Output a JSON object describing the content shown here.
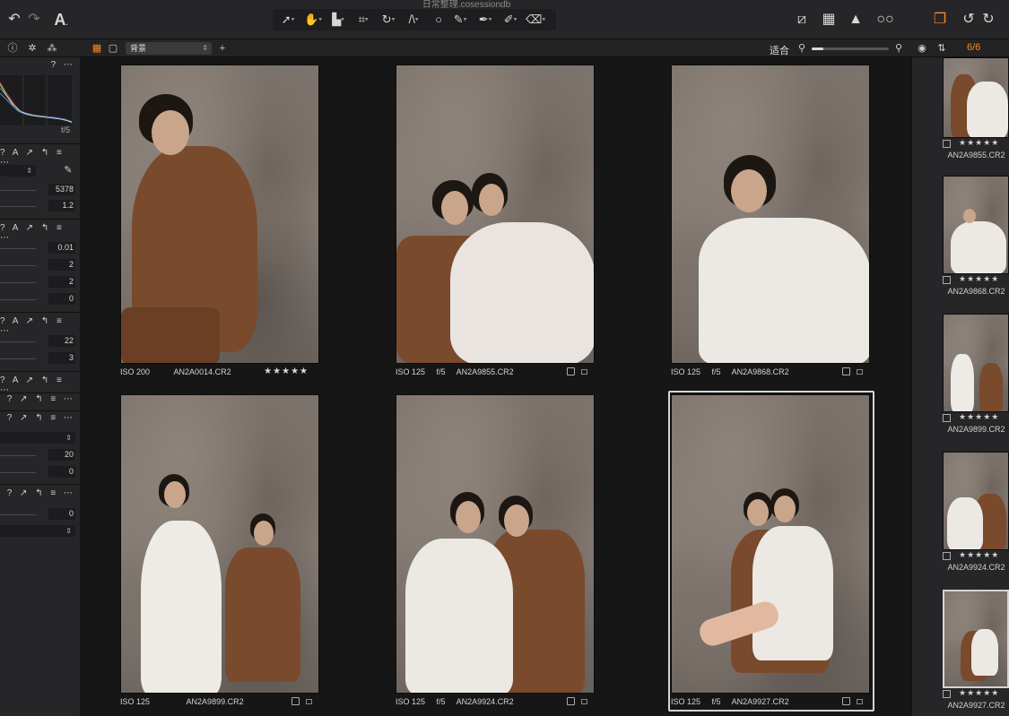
{
  "window": {
    "title": "日常整理.cosessiondb"
  },
  "toolbar": {
    "left_icons": [
      "undo-icon",
      "redo-icon",
      "text-tool-icon"
    ],
    "tools": [
      "select-cursor-icon",
      "pan-hand-icon",
      "stack-icon",
      "crop-icon",
      "rotate-icon",
      "keystone-icon",
      "spot-circle-icon",
      "brush-icon",
      "pen-icon",
      "eraser-icon",
      "gradient-icon"
    ],
    "right_icons": [
      "overlay-icon",
      "grid-icon",
      "warning-icon",
      "glasses-icon",
      "layers-icon",
      "rotate-left-icon",
      "rotate-right-icon"
    ]
  },
  "subbar": {
    "layer_select": "背景",
    "fit_label": "适合",
    "zoom_fraction": 0.15,
    "image_count": "6/6"
  },
  "left_panel": {
    "histogram_label": "f/5",
    "rows_a": [
      "5378",
      "1.2"
    ],
    "rows_b": [
      "0.01",
      "2",
      "2",
      "0"
    ],
    "rows_c": [
      "22",
      "3"
    ],
    "rows_d": [
      "20",
      "0"
    ],
    "rows_e": [
      "0"
    ],
    "header_icons": "? A ↗ ↰ ≡ ⋯"
  },
  "thumbnails": [
    {
      "iso": "ISO 200",
      "aperture": "",
      "name": "AN2A0014.CR2",
      "stars": "★★★★★",
      "selected": false
    },
    {
      "iso": "ISO 125",
      "aperture": "f/5",
      "name": "AN2A9855.CR2",
      "stars": "",
      "selected": false
    },
    {
      "iso": "ISO 125",
      "aperture": "f/5",
      "name": "AN2A9868.CR2",
      "stars": "",
      "selected": false
    },
    {
      "iso": "ISO 125",
      "aperture": "",
      "name": "AN2A9899.CR2",
      "stars": "",
      "selected": false
    },
    {
      "iso": "ISO 125",
      "aperture": "f/5",
      "name": "AN2A9924.CR2",
      "stars": "",
      "selected": false
    },
    {
      "iso": "ISO 125",
      "aperture": "f/5",
      "name": "AN2A9927.CR2",
      "stars": "",
      "selected": true
    }
  ],
  "filmstrip": [
    {
      "name": "AN2A9855.CR2",
      "stars": "★★★★★"
    },
    {
      "name": "AN2A9868.CR2",
      "stars": "★★★★★"
    },
    {
      "name": "AN2A9899.CR2",
      "stars": "★★★★★"
    },
    {
      "name": "AN2A9924.CR2",
      "stars": "★★★★★"
    },
    {
      "name": "AN2A9927.CR2",
      "stars": "★★★★★"
    }
  ],
  "colors": {
    "accent": "#ff8a1e",
    "selection": "#d4d4d4"
  }
}
